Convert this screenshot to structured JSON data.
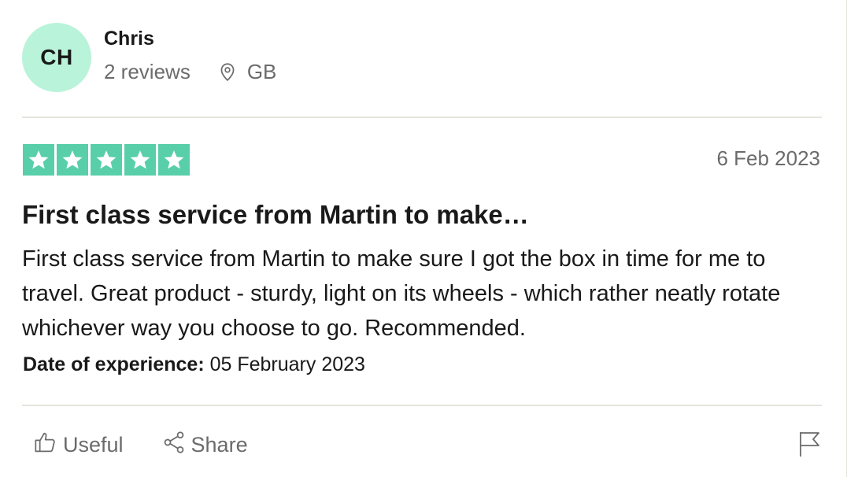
{
  "consumer": {
    "initials": "CH",
    "name": "Chris",
    "reviews_count": "2 reviews",
    "country": "GB"
  },
  "review": {
    "rating": 5,
    "date": "6 Feb 2023",
    "title": "First class service from Martin to make…",
    "body": "First class service from Martin to make sure I got the box in time for me to travel. Great product - sturdy, light on its wheels - which rather neatly rotate whichever way you choose to go. Recommended.",
    "experience_label": "Date of experience:",
    "experience_date": "05 February 2023"
  },
  "actions": {
    "useful_label": "Useful",
    "share_label": "Share"
  },
  "icons": {
    "location": "location-pin-icon",
    "star": "star-icon",
    "useful": "thumbs-up-icon",
    "share": "share-icon",
    "flag": "flag-icon"
  },
  "colors": {
    "avatar_bg": "#b9f3d9",
    "star_bg": "#00b67a",
    "muted_text": "#6b6b6b",
    "divider": "#e5e5dd"
  }
}
